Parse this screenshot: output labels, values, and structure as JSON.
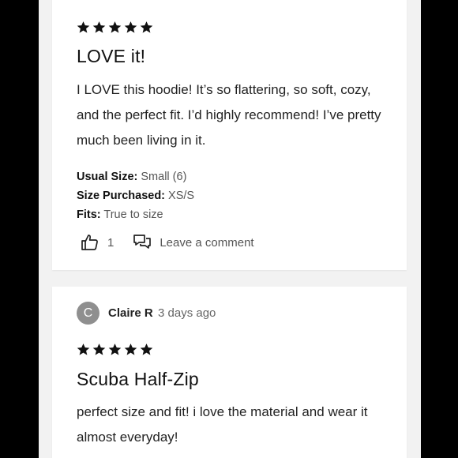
{
  "reviews": [
    {
      "rating": 5,
      "title": "LOVE it!",
      "body": "I LOVE this hoodie! It’s so flattering, so soft, cozy, and the perfect fit. I’d highly recommend! I’ve pretty much been living in it.",
      "usual_size_label": "Usual Size:",
      "usual_size": "Small (6)",
      "size_purchased_label": "Size Purchased:",
      "size_purchased": "XS/S",
      "fits_label": "Fits:",
      "fits": "True to size",
      "likes": "1",
      "comment_label": "Leave a comment"
    },
    {
      "avatar_initial": "C",
      "author": "Claire R",
      "time_ago": "3 days ago",
      "rating": 5,
      "title": "Scuba Half-Zip",
      "body": "perfect size and fit! i love the material and wear it almost everyday!"
    }
  ],
  "icons": {
    "star": "star-icon",
    "like": "thumbs-up-icon",
    "comment": "comment-icon"
  }
}
